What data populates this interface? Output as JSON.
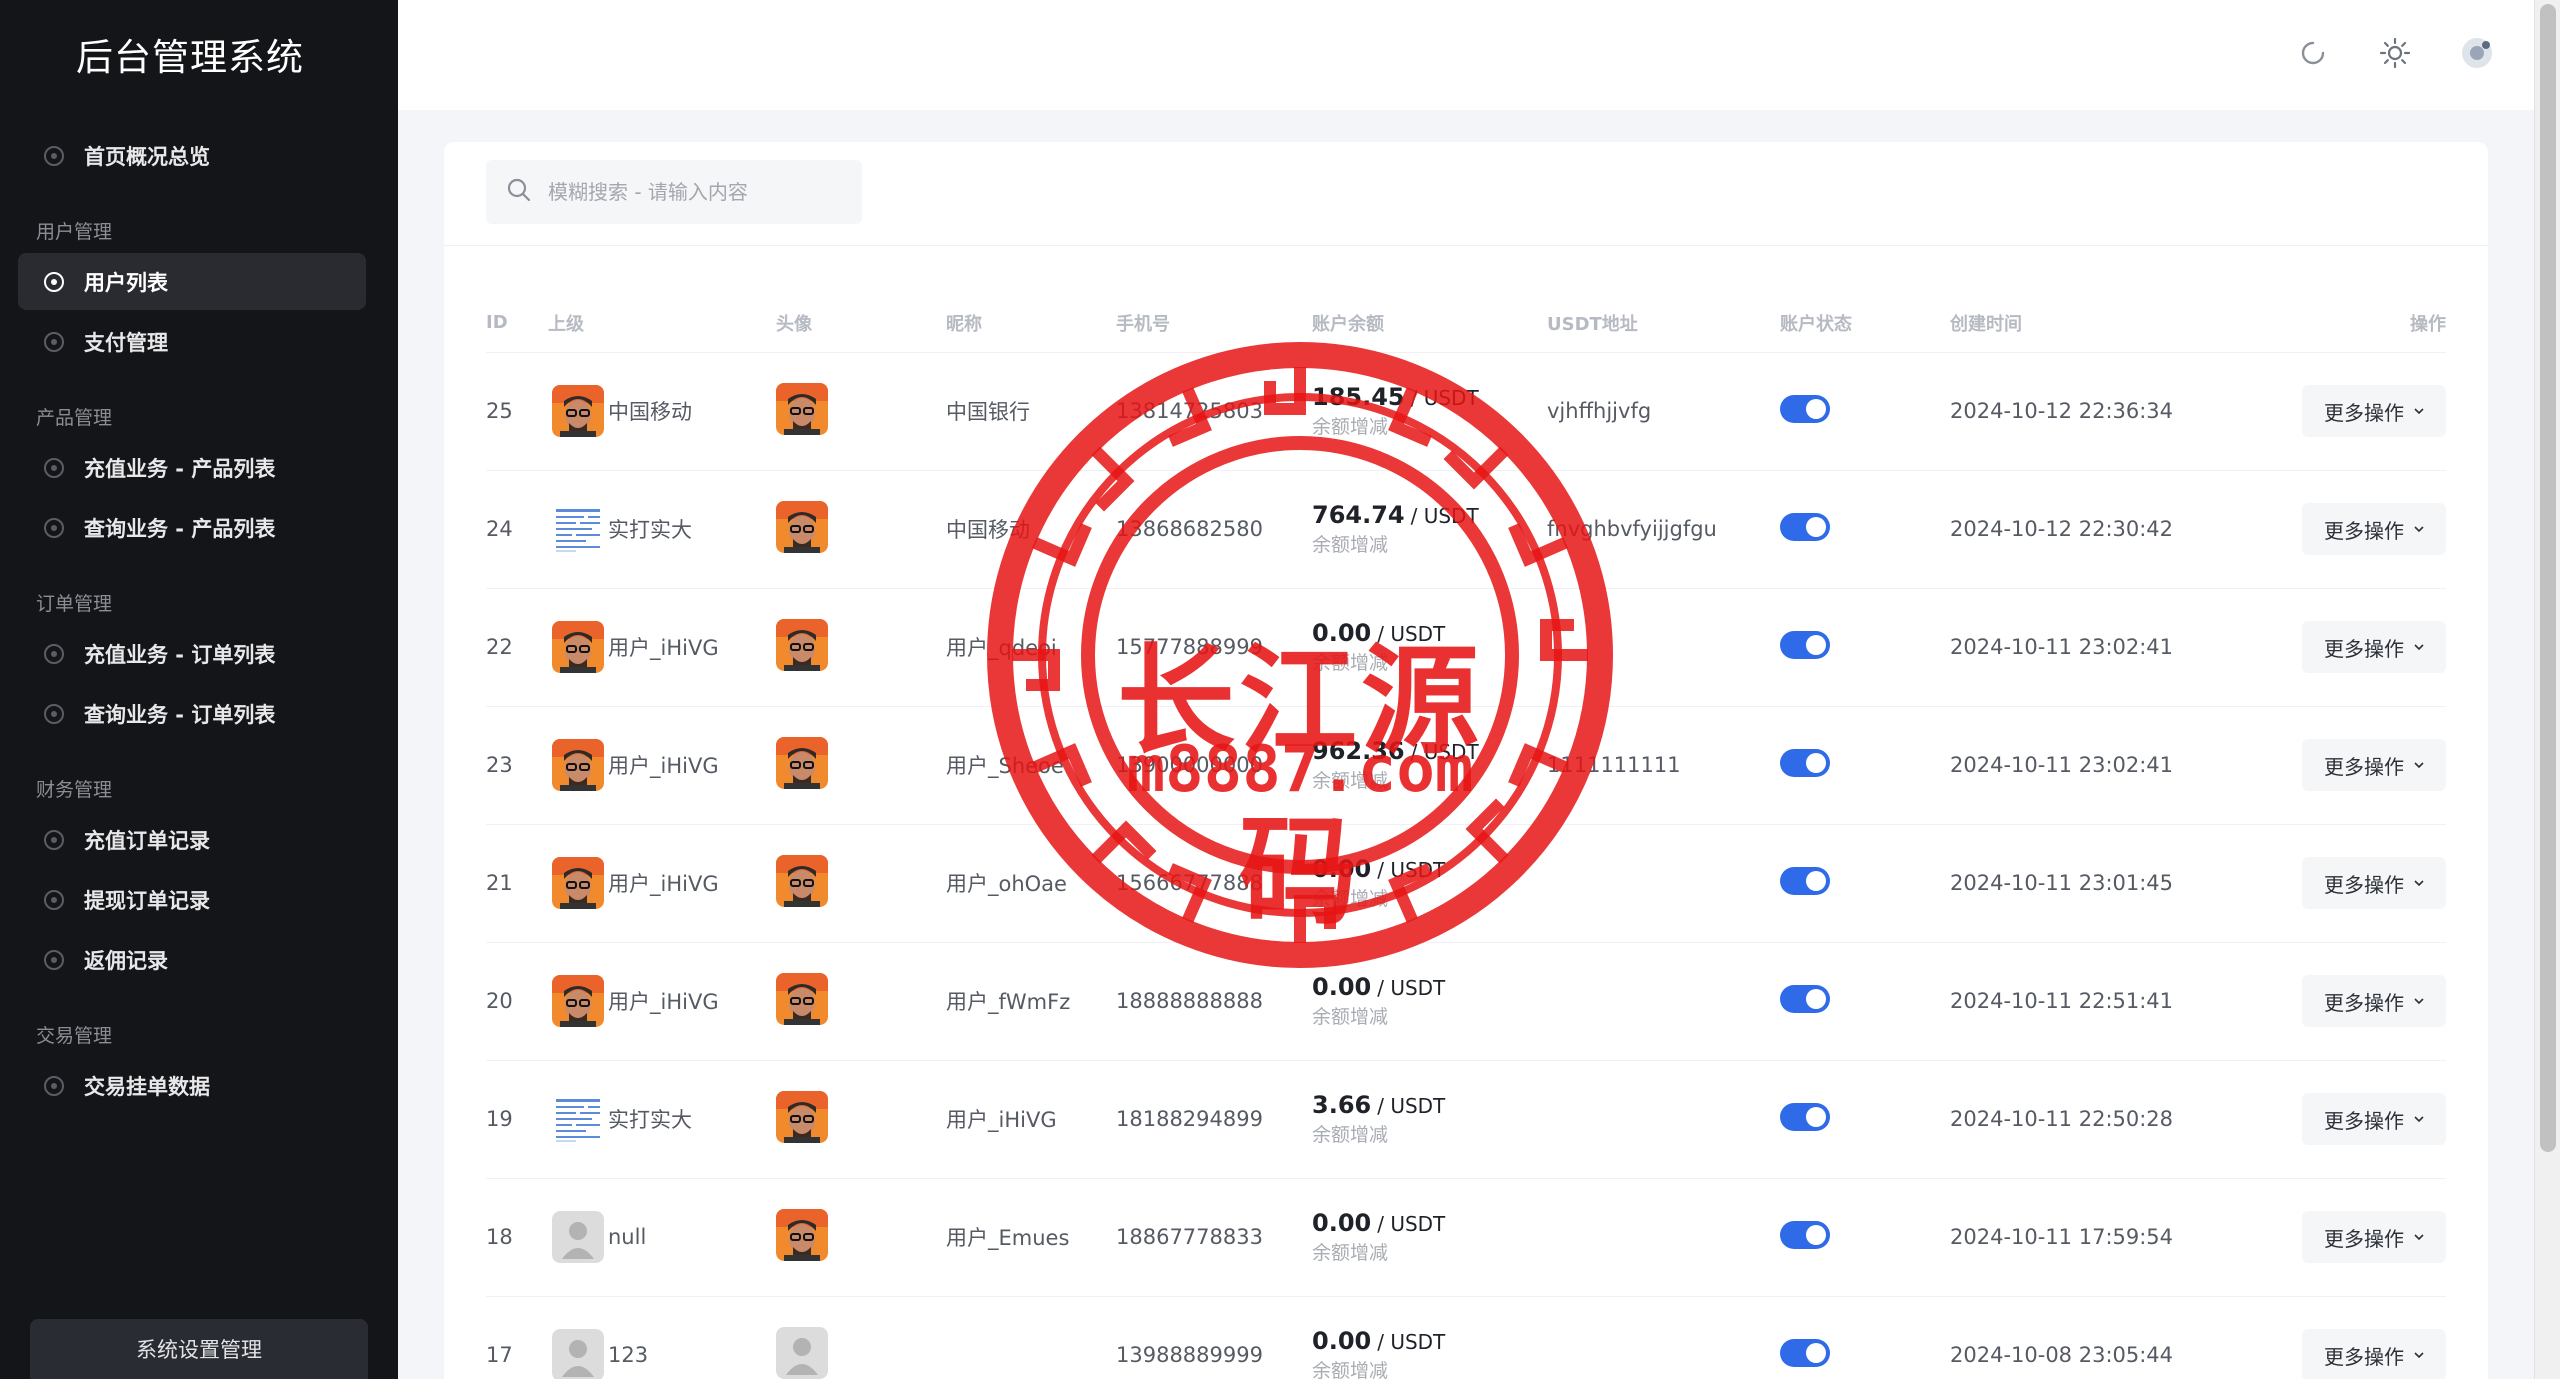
{
  "sidebar": {
    "brand": "后台管理系统",
    "home": "首页概况总览",
    "groups": [
      {
        "title": "用户管理",
        "items": [
          "用户列表",
          "支付管理"
        ]
      },
      {
        "title": "产品管理",
        "items": [
          "充值业务 - 产品列表",
          "查询业务 - 产品列表"
        ]
      },
      {
        "title": "订单管理",
        "items": [
          "充值业务 - 订单列表",
          "查询业务 - 订单列表"
        ]
      },
      {
        "title": "财务管理",
        "items": [
          "充值订单记录",
          "提现订单记录",
          "返佣记录"
        ]
      },
      {
        "title": "交易管理",
        "items": [
          "交易挂单数据"
        ]
      }
    ],
    "active": "用户列表",
    "system_button": "系统设置管理"
  },
  "header": {
    "icons": [
      "refresh-icon",
      "sun-icon",
      "user-avatar-icon"
    ]
  },
  "search": {
    "placeholder": "模糊搜索 - 请输入内容"
  },
  "table": {
    "columns": {
      "id": "ID",
      "parent": "上级",
      "avatar": "头像",
      "nickname": "昵称",
      "phone": "手机号",
      "balance": "账户余额",
      "usdt": "USDT地址",
      "status": "账户状态",
      "created": "创建时间",
      "op": "操作"
    },
    "unit": "/ USDT",
    "adjust_label": "余额增减",
    "more_label": "更多操作",
    "rows": [
      {
        "id": "25",
        "parent": "中国移动",
        "parent_avatar": "photo",
        "avatar": "photo",
        "nickname": "中国银行",
        "phone": "13814725803",
        "balance": "185.45",
        "usdt": "vjhffhjjvfg",
        "status": true,
        "created": "2024-10-12 22:36:34"
      },
      {
        "id": "24",
        "parent": "实打实大",
        "parent_avatar": "doc",
        "avatar": "photo",
        "nickname": "中国移动",
        "phone": "13868682580",
        "balance": "764.74",
        "usdt": "fnvghbvfyijjgfgu",
        "status": true,
        "created": "2024-10-12 22:30:42"
      },
      {
        "id": "22",
        "parent": "用户_iHiVG",
        "parent_avatar": "photo",
        "avatar": "photo",
        "nickname": "用户_qdeoi",
        "phone": "15777888999",
        "balance": "0.00",
        "usdt": "",
        "status": true,
        "created": "2024-10-11 23:02:41"
      },
      {
        "id": "23",
        "parent": "用户_iHiVG",
        "parent_avatar": "photo",
        "avatar": "photo",
        "nickname": "用户_Sheoe",
        "phone": "13900000000",
        "balance": "962.36",
        "usdt": "1111111111",
        "status": true,
        "created": "2024-10-11 23:02:41"
      },
      {
        "id": "21",
        "parent": "用户_iHiVG",
        "parent_avatar": "photo",
        "avatar": "photo",
        "nickname": "用户_ohOae",
        "phone": "15666777888",
        "balance": "0.00",
        "usdt": "",
        "status": true,
        "created": "2024-10-11 23:01:45"
      },
      {
        "id": "20",
        "parent": "用户_iHiVG",
        "parent_avatar": "photo",
        "avatar": "photo",
        "nickname": "用户_fWmFz",
        "phone": "18888888888",
        "balance": "0.00",
        "usdt": "",
        "status": true,
        "created": "2024-10-11 22:51:41"
      },
      {
        "id": "19",
        "parent": "实打实大",
        "parent_avatar": "doc",
        "avatar": "photo",
        "nickname": "用户_iHiVG",
        "phone": "18188294899",
        "balance": "3.66",
        "usdt": "",
        "status": true,
        "created": "2024-10-11 22:50:28"
      },
      {
        "id": "18",
        "parent": "null",
        "parent_avatar": "default",
        "avatar": "photo",
        "nickname": "用户_Emues",
        "phone": "18867778833",
        "balance": "0.00",
        "usdt": "",
        "status": true,
        "created": "2024-10-11 17:59:54"
      },
      {
        "id": "17",
        "parent": "123",
        "parent_avatar": "default",
        "avatar": "default",
        "nickname": "",
        "phone": "13988889999",
        "balance": "0.00",
        "usdt": "",
        "status": true,
        "created": "2024-10-08 23:05:44"
      }
    ]
  },
  "watermark": {
    "title": "长江源码",
    "url": "m8887.com",
    "color": "#e61414"
  }
}
